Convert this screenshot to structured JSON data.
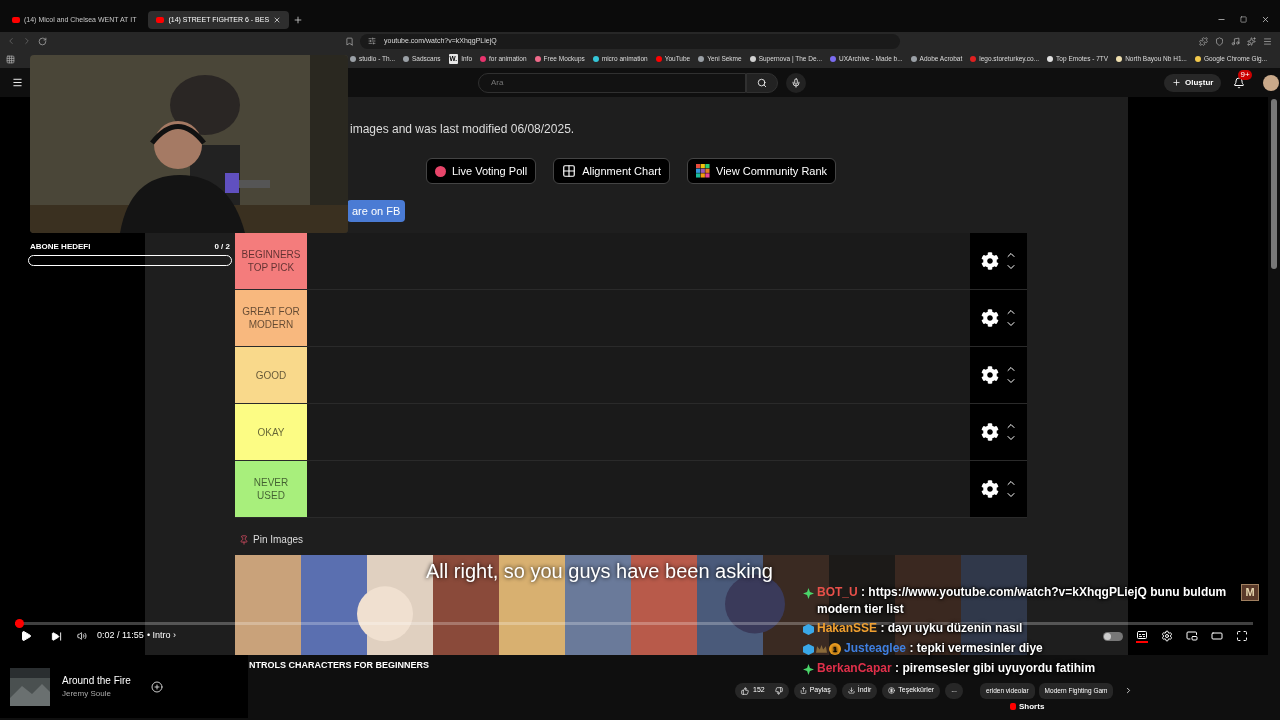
{
  "browser": {
    "tabs": [
      {
        "title": "(14) Micol and Chelsea WENT AT IT",
        "selected": false
      },
      {
        "title": "(14) STREET FIGHTER 6 - BES",
        "selected": true
      }
    ],
    "url": "youtube.com/watch?v=kXhqgPLiejQ",
    "bookmarks": [
      {
        "title": "studio - Th...",
        "color": "#9aa0a6"
      },
      {
        "title": "Sadscans",
        "color": "#9aa0a6"
      },
      {
        "title": "Info",
        "color": "#e8e8e8",
        "icon_text": "W."
      },
      {
        "title": "for animation",
        "color": "#e8336d"
      },
      {
        "title": "Free Mockups",
        "color": "#f06a8a"
      },
      {
        "title": "micro animation",
        "color": "#35c6d8"
      },
      {
        "title": "YouTube",
        "color": "#ff0000"
      },
      {
        "title": "Yeni Sekme",
        "color": "#9aa0a6"
      },
      {
        "title": "Supernova | The De...",
        "color": "#d0d0d0"
      },
      {
        "title": "UXArchive - Made b...",
        "color": "#7b6cf0"
      },
      {
        "title": "Adobe Acrobat",
        "color": "#9aa0a6"
      },
      {
        "title": "lego.storeturkey.co...",
        "color": "#e02020"
      },
      {
        "title": "Top Emotes - 7TV",
        "color": "#e0e0e0"
      },
      {
        "title": "North Bayou Nb H1...",
        "color": "#f0e0b0"
      },
      {
        "title": "Google Chrome Gig...",
        "color": "#f2c94c"
      }
    ]
  },
  "youtube_header": {
    "search": {
      "placeholder": "Ara"
    },
    "create_button": "Oluştur",
    "notification_count": "9+"
  },
  "video": {
    "page_text": "images and was last modified 06/08/2025.",
    "buttons": [
      {
        "label": "Live Voting Poll",
        "kind": "dot"
      },
      {
        "label": "Alignment Chart",
        "kind": "grid"
      },
      {
        "label": "View Community Rank",
        "kind": "mosaic"
      }
    ],
    "share_button": "are on FB",
    "tiers": [
      {
        "label": "BEGINNERS TOP PICK",
        "color": "#f47c7c"
      },
      {
        "label": "GREAT FOR MODERN",
        "color": "#f8b87e"
      },
      {
        "label": "GOOD",
        "color": "#f9d98b"
      },
      {
        "label": "OKAY",
        "color": "#fcfc84"
      },
      {
        "label": "NEVER USED",
        "color": "#a8ef7c"
      }
    ],
    "pin_images": "Pin Images",
    "subtitle": "All right, so you guys have been asking"
  },
  "player": {
    "progress": {
      "level": 0.003
    },
    "time": "0:02 / 11:55",
    "chapter": "• Intro ›",
    "autoplay": {
      "on": false
    },
    "captions": {
      "on": true
    }
  },
  "webcam": {
    "goal_label": "ABONE HEDEFI",
    "goal_count": "0 / 2",
    "goal": {
      "level": 0
    }
  },
  "chat": {
    "badge": "M",
    "messages": [
      {
        "user": "BOT_U",
        "color": "#e8504a",
        "text": ": https://www.youtube.com/watch?v=kXhqgPLiejQ bunu buldum modern tier list",
        "badges": [
          {
            "kind": "sparkle"
          }
        ]
      },
      {
        "user": "HakanSSE",
        "color": "#f0a030",
        "text": ": dayı uyku düzenin nasıl",
        "badges": [
          {
            "kind": "cube"
          }
        ]
      },
      {
        "user": "Justeaglee",
        "color": "#3f7fe0",
        "text": ": tepki vermesinler diye",
        "badges": [
          {
            "kind": "cube"
          },
          {
            "kind": "crown"
          },
          {
            "kind": "coin",
            "text": "1"
          }
        ]
      },
      {
        "user": "BerkanCapar",
        "color": "#e0304a",
        "text": ": piremsesler gibi uyuyordu fatihim",
        "badges": [
          {
            "kind": "sparkle"
          }
        ]
      }
    ]
  },
  "below": {
    "title": "NTROLS CHARACTERS FOR BEGINNERS",
    "likes": "152",
    "actions": [
      "Paylaş",
      "İndir",
      "Teşekkürler",
      "..."
    ],
    "chips": [
      "eriden videolar",
      "Modern Fighting Gam"
    ],
    "shorts": "Shorts"
  },
  "music": {
    "title": "Around the Fire",
    "artist": "Jeremy Soule"
  }
}
